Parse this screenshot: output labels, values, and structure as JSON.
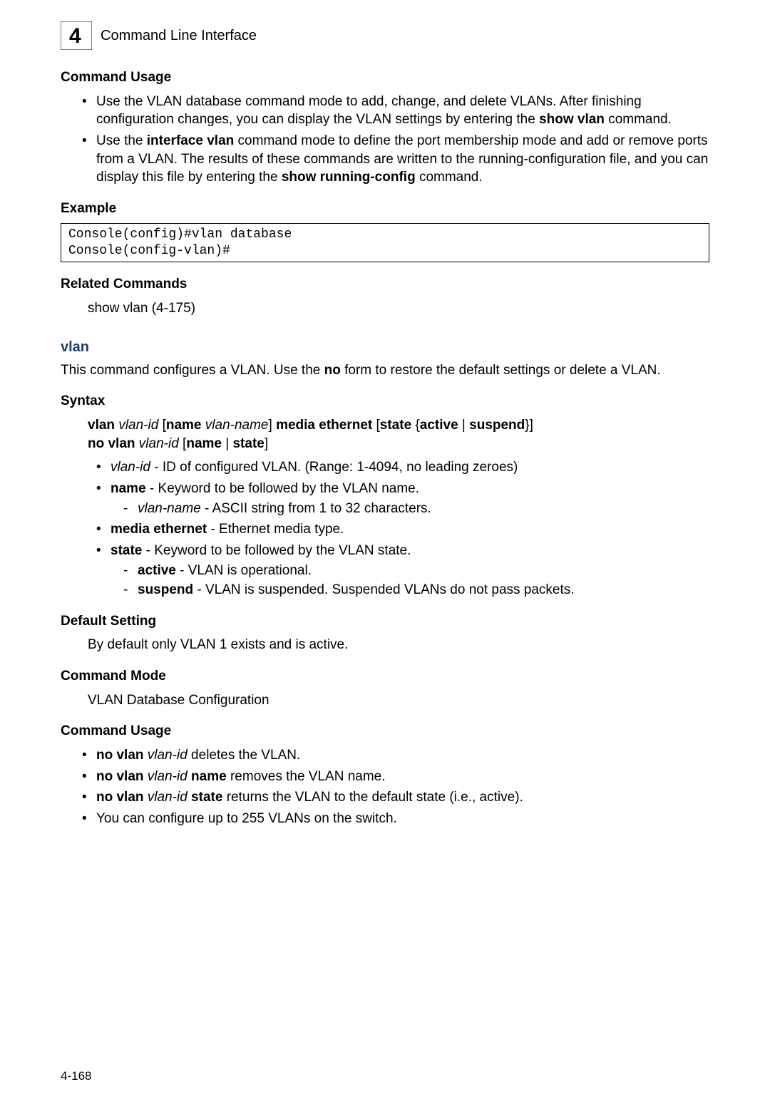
{
  "header": {
    "chapter_number": "4",
    "title": "Command Line Interface"
  },
  "sec_usage1": {
    "head": "Command Usage",
    "b1_a": "Use the VLAN database command mode to add, change, and delete VLANs. After finishing configuration changes, you can display the VLAN settings by entering the ",
    "b1_bold": "show vlan",
    "b1_c": " command.",
    "b2_a": "Use the ",
    "b2_bold1": "interface vlan",
    "b2_b": " command mode to define the port membership mode and add or remove ports from a VLAN. The results of these commands are written to the running-configuration file, and you can display this file by entering the ",
    "b2_bold2": "show running-config",
    "b2_c": " command."
  },
  "sec_example": {
    "head": "Example",
    "code": "Console(config)#vlan database\nConsole(config-vlan)#"
  },
  "sec_related": {
    "head": "Related Commands",
    "text": "show vlan (4-175)"
  },
  "cmd": {
    "title": "vlan",
    "desc_a": "This command configures a VLAN. Use the ",
    "desc_bold": "no",
    "desc_b": " form to restore the default settings or delete a VLAN."
  },
  "sec_syntax": {
    "head": "Syntax",
    "l1": {
      "a": "vlan ",
      "b": "vlan-id",
      "c": " [",
      "d": "name ",
      "e": "vlan-name",
      "f": "] ",
      "g": "media ethernet",
      "h": " [",
      "i": "state",
      "j": " {",
      "k": "active",
      "l": " | ",
      "m": "suspend",
      "n": "}]"
    },
    "l2": {
      "a": "no vlan ",
      "b": "vlan-id",
      "c": " [",
      "d": "name",
      "e": " | ",
      "f": "state",
      "g": "]"
    },
    "p_vlanid": {
      "a": "vlan-id",
      "b": " - ID of configured VLAN. (Range: 1-4094, no leading zeroes)"
    },
    "p_name": {
      "a": "name",
      "b": " - Keyword to be followed by the VLAN name."
    },
    "p_vlanname": {
      "a": "vlan-name",
      "b": " - ASCII string from 1 to 32 characters."
    },
    "p_media": {
      "a": "media ethernet",
      "b": " - Ethernet media type."
    },
    "p_state": {
      "a": "state",
      "b": " - Keyword to be followed by the VLAN state."
    },
    "p_active": {
      "a": "active",
      "b": " - VLAN is operational."
    },
    "p_suspend": {
      "a": "suspend",
      "b": " - VLAN is suspended. Suspended VLANs do not pass packets."
    }
  },
  "sec_default": {
    "head": "Default Setting",
    "text": "By default only VLAN 1 exists and is active."
  },
  "sec_mode": {
    "head": "Command Mode",
    "text": "VLAN Database Configuration"
  },
  "sec_usage2": {
    "head": "Command Usage",
    "u1": {
      "a": "no vlan ",
      "b": "vlan-id",
      "c": " deletes the VLAN."
    },
    "u2": {
      "a": "no vlan ",
      "b": "vlan-id",
      "c": " name",
      "d": " removes the VLAN name."
    },
    "u3": {
      "a": "no vlan ",
      "b": "vlan-id",
      "c": " state",
      "d": " returns the VLAN to the default state (i.e., active)."
    },
    "u4": "You can configure up to 255 VLANs on the switch."
  },
  "footer": "4-168"
}
